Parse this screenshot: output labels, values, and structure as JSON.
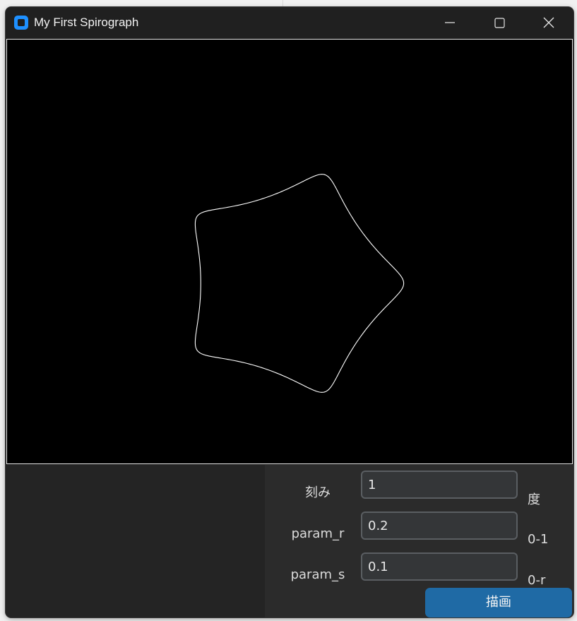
{
  "window": {
    "title": "My First Spirograph"
  },
  "controls": {
    "window_buttons": [
      "minimize-icon",
      "maximize-icon",
      "close-icon"
    ]
  },
  "form": {
    "step": {
      "label": "刻み",
      "value": "1",
      "unit": "度"
    },
    "param_r": {
      "label": "param_r",
      "value": "0.2",
      "unit": "0-1"
    },
    "param_s": {
      "label": "param_s",
      "value": "0.1",
      "unit": "0-r"
    },
    "draw_label": "描画"
  },
  "colors": {
    "accent": "#1f6aa5",
    "canvas_bg": "#000000",
    "curve": "#ffffff",
    "panel": "#2b2b2b"
  }
}
